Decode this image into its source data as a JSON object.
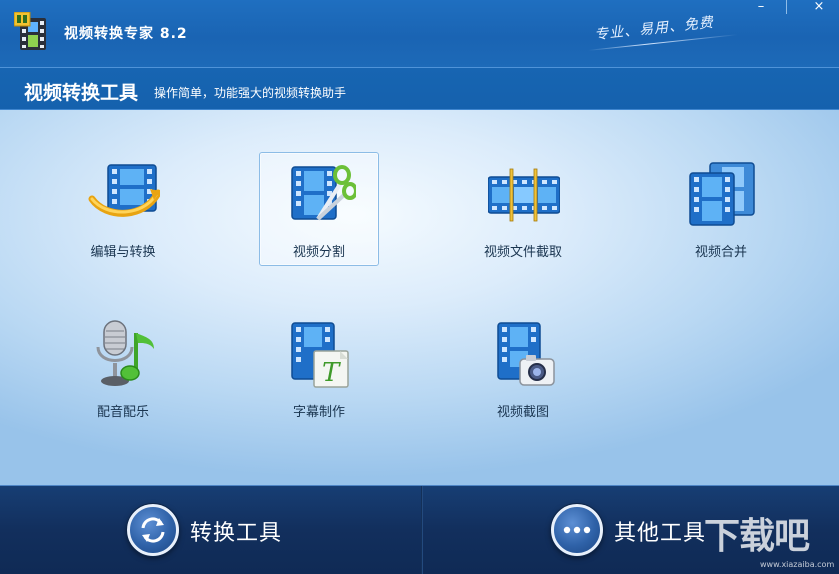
{
  "window": {
    "title": "视频转换专家 8.2",
    "slogan": "专业、易用、免费",
    "controls": {
      "minimize": "–",
      "close": "×"
    }
  },
  "header": {
    "title": "视频转换工具",
    "subtitle": "操作简单，功能强大的视频转换助手"
  },
  "tools": [
    {
      "label": "编辑与转换",
      "icon": "film-convert-icon"
    },
    {
      "label": "视频分割",
      "icon": "film-scissors-icon",
      "selected": true
    },
    {
      "label": "视频文件截取",
      "icon": "film-trim-icon"
    },
    {
      "label": "视频合并",
      "icon": "film-merge-icon"
    },
    {
      "label": "配音配乐",
      "icon": "microphone-music-icon"
    },
    {
      "label": "字幕制作",
      "icon": "film-subtitle-icon"
    },
    {
      "label": "视频截图",
      "icon": "film-camera-icon"
    }
  ],
  "bottom_tabs": [
    {
      "label": "转换工具",
      "icon": "refresh-icon",
      "active": true
    },
    {
      "label": "其他工具",
      "icon": "more-dots-icon",
      "active": false
    }
  ],
  "watermark": {
    "text": "下载吧",
    "url": "www.xiazaiba.com"
  },
  "colors": {
    "titlebar": "#1f6fc0",
    "header": "#1765b2",
    "bottom": "#122f5d",
    "selected_border": "#8cbce6"
  }
}
